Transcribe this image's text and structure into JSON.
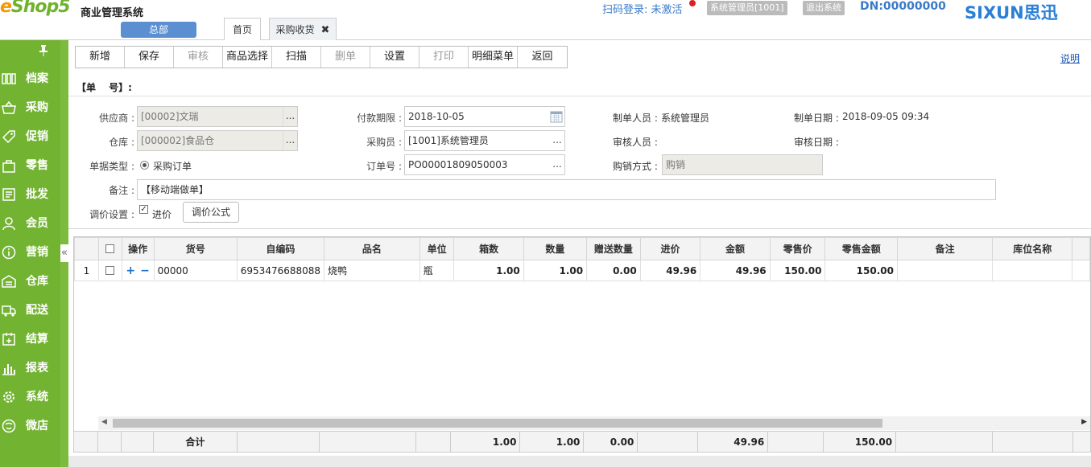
{
  "header": {
    "logo_e": "e",
    "logo_rest": "Shop5",
    "system_title": "商业管理系统",
    "branch": "总部",
    "tabs": [
      {
        "label": "首页"
      },
      {
        "label": "采购收货",
        "close": "✖"
      }
    ],
    "scan_login": "扫码登录: 未激活",
    "user": "系统管理员[1001]",
    "logout": "退出系统",
    "dn": "DN:00000000",
    "brand": "SIXUN思迅",
    "colors": {
      "green": "#72b332",
      "blue": "#3a7bc8",
      "orange": "#f39800"
    }
  },
  "sidebar": {
    "pin_icon": "pin-icon",
    "collapse": "«",
    "items": [
      {
        "label": "档案",
        "icon": "archive-icon"
      },
      {
        "label": "采购",
        "icon": "basket-icon"
      },
      {
        "label": "促销",
        "icon": "tag-icon"
      },
      {
        "label": "零售",
        "icon": "bag-icon"
      },
      {
        "label": "批发",
        "icon": "wholesale-icon"
      },
      {
        "label": "会员",
        "icon": "user-icon"
      },
      {
        "label": "营销",
        "icon": "info-icon"
      },
      {
        "label": "仓库",
        "icon": "warehouse-icon"
      },
      {
        "label": "配送",
        "icon": "truck-icon"
      },
      {
        "label": "结算",
        "icon": "settle-icon"
      },
      {
        "label": "报表",
        "icon": "chart-icon"
      },
      {
        "label": "系统",
        "icon": "gear-icon"
      },
      {
        "label": "微店",
        "icon": "shop-icon"
      }
    ]
  },
  "toolbar": {
    "buttons": [
      {
        "label": "新增",
        "disabled": false
      },
      {
        "label": "保存",
        "disabled": false
      },
      {
        "label": "审核",
        "disabled": true
      },
      {
        "label": "商品选择",
        "disabled": false
      },
      {
        "label": "扫描",
        "disabled": false
      },
      {
        "label": "删单",
        "disabled": true
      },
      {
        "label": "设置",
        "disabled": false
      },
      {
        "label": "打印",
        "disabled": true
      },
      {
        "label": "明细菜单",
        "disabled": false
      },
      {
        "label": "返回",
        "disabled": false
      }
    ],
    "help": "说明"
  },
  "form": {
    "doc_no_label": "【单　 号】:",
    "supplier_label": "供应商 :",
    "supplier_value": "[00002]文瑞",
    "warehouse_label": "仓库 :",
    "warehouse_value": "[000002]食品仓",
    "doctype_label": "单据类型 :",
    "doctype_value": "采购订单",
    "remark_label": "备注 :",
    "remark_value": "【移动端做单】",
    "pricing_label": "调价设置 :",
    "pricing_check": "进价",
    "pricing_button": "调价公式",
    "payterm_label": "付款期限 :",
    "payterm_value": "2018-10-05",
    "buyer_label": "采购员 :",
    "buyer_value": "[1001]系统管理员",
    "order_label": "订单号 :",
    "order_value": "PO00001809050003",
    "creator_label": "制单人员 :",
    "creator_value": "系统管理员",
    "auditor_label": "审核人员 :",
    "auditor_value": "",
    "method_label": "购销方式 :",
    "method_value": "购销",
    "create_date_label": "制单日期 :",
    "create_date_value": "2018-09-05 09:34",
    "audit_date_label": "审核日期 :",
    "audit_date_value": "",
    "dots": "..."
  },
  "grid": {
    "headers": [
      "",
      "",
      "操作",
      "货号",
      "自编码",
      "品名",
      "单位",
      "箱数",
      "数量",
      "赠送数量",
      "进价",
      "金额",
      "零售价",
      "零售金额",
      "备注",
      "库位名称",
      ""
    ],
    "rows": [
      {
        "idx": "1",
        "code": "00000",
        "selfcode": "6953476688088",
        "name": "烧鸭",
        "unit": "瓶",
        "boxes": "1.00",
        "qty": "1.00",
        "gift": "0.00",
        "price": "49.96",
        "amount": "49.96",
        "retail": "150.00",
        "retail_amount": "150.00",
        "remark": "",
        "location": ""
      }
    ],
    "footer": {
      "label": "合计",
      "boxes": "1.00",
      "qty": "1.00",
      "gift": "0.00",
      "amount": "49.96",
      "retail_amount": "150.00"
    }
  }
}
